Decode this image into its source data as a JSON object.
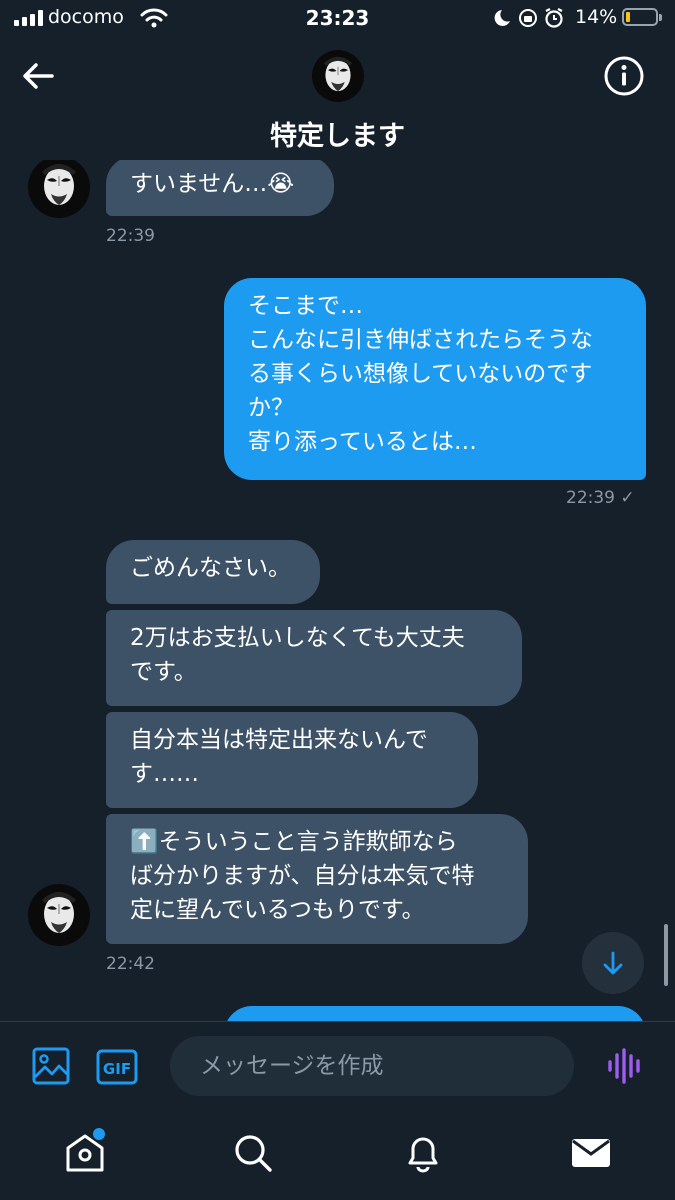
{
  "status_bar": {
    "carrier": "docomo",
    "time": "23:23",
    "battery_percent": "14%",
    "battery_level": 0.14,
    "icons": [
      "signal-icon",
      "wifi-icon",
      "moon-icon",
      "orientation-lock-icon",
      "alarm-icon",
      "battery-icon"
    ]
  },
  "header": {
    "title": "特定します",
    "back_icon": "back-arrow-icon",
    "info_icon": "info-icon"
  },
  "messages": [
    {
      "direction": "incoming",
      "text": "すいません…😭"
    },
    {
      "direction": "timestamp-in",
      "text": "22:39"
    },
    {
      "direction": "outgoing",
      "text": "そこまで…\nこんなに引き伸ばされたらそうな\nる事くらい想像していないのです\nか？\n寄り添っているとは…"
    },
    {
      "direction": "timestamp-out",
      "text": "22:39 ✓"
    },
    {
      "direction": "incoming",
      "text": "ごめんなさい。"
    },
    {
      "direction": "incoming",
      "text": "2万はお支払いしなくても大丈夫\nです。"
    },
    {
      "direction": "incoming",
      "text": "自分本当は特定出来ないんで\nす……"
    },
    {
      "direction": "incoming",
      "text": "⬆️そういうこと言う詐欺師なら\nば分かりますが、自分は本気で特\n定に望んでいるつもりです。"
    },
    {
      "direction": "timestamp-in",
      "text": "22:42"
    }
  ],
  "compose": {
    "placeholder": "メッセージを作成",
    "gif_label": "GIF",
    "image_icon": "image-icon",
    "voice_icon": "voice-icon"
  },
  "tab_bar": {
    "items": [
      "home-icon",
      "search-icon",
      "notifications-icon",
      "messages-icon"
    ],
    "home_has_badge": true
  },
  "colors": {
    "background": "#15202b",
    "incoming_bubble": "#3d5266",
    "outgoing_bubble": "#1d9bf0",
    "accent": "#1d9bf0",
    "voice_accent": "#a05cf0"
  }
}
